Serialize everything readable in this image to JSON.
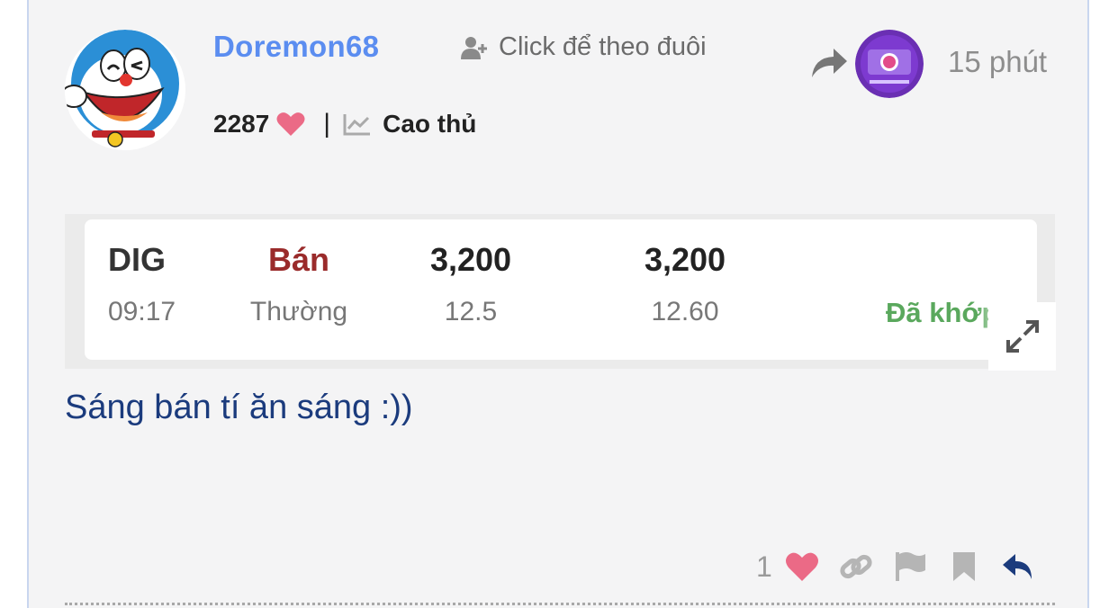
{
  "author": {
    "username": "Doremon68",
    "follow_label": "Click để theo đuôi",
    "likes_received": "2287",
    "rank": "Cao thủ"
  },
  "post": {
    "time_ago": "15 phút",
    "content": "Sáng bán tí ăn sáng :))",
    "like_count": "1"
  },
  "order": {
    "symbol": "DIG",
    "time": "09:17",
    "side": "Bán",
    "order_type": "Thường",
    "order_quantity": "3,200",
    "order_price": "12.5",
    "matched_quantity": "3,200",
    "matched_price": "12.60",
    "status": "Đã khớp"
  },
  "icons": {
    "follow": "add-user-icon",
    "heart": "heart-icon",
    "rank": "trend-chart-icon",
    "share": "share-icon",
    "expand": "expand-icon",
    "link": "link-icon",
    "report": "flag-icon",
    "bookmark": "bookmark-icon",
    "reply": "reply-icon"
  },
  "colors": {
    "username": "#5b8df0",
    "sell": "#9a2b2b",
    "matched_status": "#5aa85d",
    "heart": "#eb6a86",
    "content_text": "#1b3b7d",
    "reply_icon": "#1b3b7d"
  }
}
